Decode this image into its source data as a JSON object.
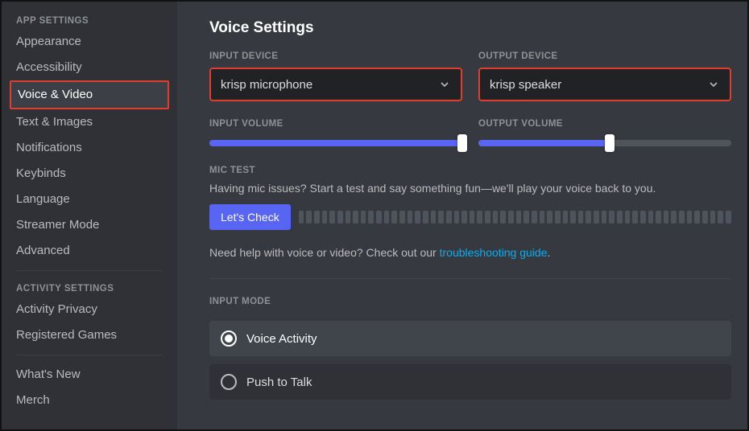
{
  "sidebar": {
    "section1_header": "APP SETTINGS",
    "items1": [
      {
        "label": "Appearance",
        "active": false
      },
      {
        "label": "Accessibility",
        "active": false
      },
      {
        "label": "Voice & Video",
        "active": true,
        "highlight": true
      },
      {
        "label": "Text & Images",
        "active": false
      },
      {
        "label": "Notifications",
        "active": false
      },
      {
        "label": "Keybinds",
        "active": false
      },
      {
        "label": "Language",
        "active": false
      },
      {
        "label": "Streamer Mode",
        "active": false
      },
      {
        "label": "Advanced",
        "active": false
      }
    ],
    "section2_header": "ACTIVITY SETTINGS",
    "items2": [
      {
        "label": "Activity Privacy"
      },
      {
        "label": "Registered Games"
      }
    ],
    "items3": [
      {
        "label": "What's New"
      },
      {
        "label": "Merch"
      }
    ]
  },
  "page": {
    "title": "Voice Settings",
    "input_device_label": "INPUT DEVICE",
    "output_device_label": "OUTPUT DEVICE",
    "input_device_value": "krisp microphone",
    "output_device_value": "krisp speaker",
    "input_volume_label": "INPUT VOLUME",
    "output_volume_label": "OUTPUT VOLUME",
    "input_volume_pct": 100,
    "output_volume_pct": 52,
    "mic_test_label": "MIC TEST",
    "mic_test_desc": "Having mic issues? Start a test and say something fun—we'll play your voice back to you.",
    "lets_check": "Let's Check",
    "help_prefix": "Need help with voice or video? Check out our ",
    "help_link": "troubleshooting guide",
    "help_suffix": ".",
    "input_mode_label": "INPUT MODE",
    "mode_voice_activity": "Voice Activity",
    "mode_push_to_talk": "Push to Talk",
    "input_mode_selected": "voice_activity"
  }
}
